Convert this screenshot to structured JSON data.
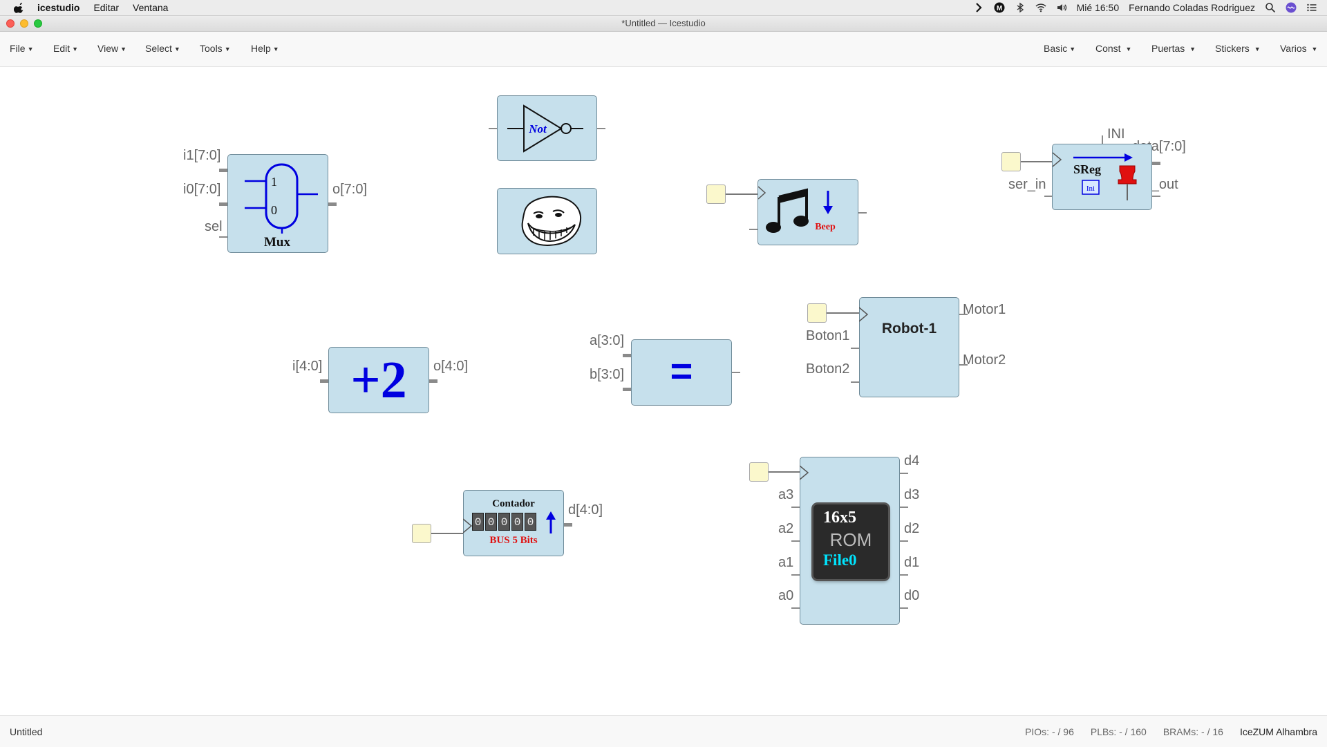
{
  "menubar": {
    "app_name": "icestudio",
    "items": [
      "Editar",
      "Ventana"
    ],
    "clock": "Mié 16:50",
    "user": "Fernando Coladas Rodriguez"
  },
  "window": {
    "title": "*Untitled — Icestudio"
  },
  "toolbar": {
    "left_menus": [
      "File",
      "Edit",
      "View",
      "Select",
      "Tools",
      "Help"
    ],
    "right_menus": [
      "Basic",
      "Const",
      "Puertas",
      "Stickers",
      "Varios"
    ]
  },
  "blocks": {
    "mux": {
      "inputs": [
        "i1[7:0]",
        "i0[7:0]",
        "sel"
      ],
      "output": "o[7:0]",
      "num1": "1",
      "num0": "0",
      "label": "Mux"
    },
    "not": {
      "label": "Not"
    },
    "beep": {
      "label": "Beep"
    },
    "sreg": {
      "top": "INI",
      "input": "ser_in",
      "outputs": [
        "data[7:0]",
        "ser_out"
      ],
      "label": "SReg",
      "ini_label": "Ini"
    },
    "plus2": {
      "input": "i[4:0]",
      "output": "o[4:0]",
      "label": "+2"
    },
    "comp": {
      "inputs": [
        "a[3:0]",
        "b[3:0]"
      ],
      "label": "="
    },
    "robot": {
      "inputs": [
        "Boton1",
        "Boton2"
      ],
      "outputs": [
        "Motor1",
        "Motor2"
      ],
      "label": "Robot-1"
    },
    "counter": {
      "output": "d[4:0]",
      "title": "Contador",
      "digits": [
        "0",
        "0",
        "0",
        "0",
        "0"
      ],
      "caption": "BUS 5 Bits"
    },
    "rom": {
      "inputs": [
        "a3",
        "a2",
        "a1",
        "a0"
      ],
      "outputs": [
        "d4",
        "d3",
        "d2",
        "d1",
        "d0"
      ],
      "size": "16x5",
      "type": "ROM",
      "file": "File0"
    }
  },
  "statusbar": {
    "file": "Untitled",
    "pios": "PIOs: - / 96",
    "plbs": "PLBs: - / 160",
    "brams": "BRAMs: - / 16",
    "board": "IceZUM Alhambra"
  },
  "colors": {
    "block_fill": "#c6e0ec",
    "block_border": "#6e8a98",
    "clock_fill": "#fbf8cc",
    "accent_blue": "#0000e0",
    "accent_red": "#e01010"
  }
}
